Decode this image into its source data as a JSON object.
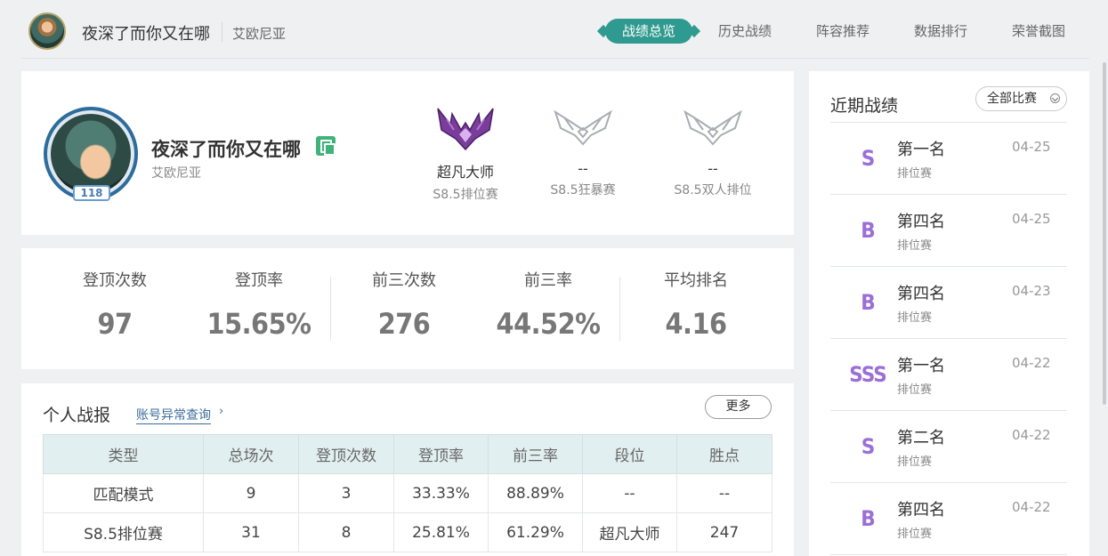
{
  "header": {
    "player_name": "夜深了而你又在哪",
    "server": "艾欧尼亚",
    "nav": [
      "战绩总览",
      "历史战绩",
      "阵容推荐",
      "数据排行",
      "荣誉截图"
    ],
    "active_nav": "战绩总览"
  },
  "profile": {
    "name": "夜深了而你又在哪",
    "server": "艾欧尼亚",
    "level": "118",
    "ranks": [
      {
        "tier": "超凡大师",
        "mode": "S8.5排位赛"
      },
      {
        "tier": "--",
        "mode": "S8.5狂暴赛"
      },
      {
        "tier": "--",
        "mode": "S8.5双人排位"
      }
    ]
  },
  "stats": [
    {
      "label": "登顶次数",
      "value": "97"
    },
    {
      "label": "登顶率",
      "value": "15.65%"
    },
    {
      "label": "前三次数",
      "value": "276"
    },
    {
      "label": "前三率",
      "value": "44.52%"
    },
    {
      "label": "平均排名",
      "value": "4.16"
    }
  ],
  "report": {
    "title": "个人战报",
    "link": "账号异常查询",
    "more": "更多",
    "columns": [
      "类型",
      "总场次",
      "登顶次数",
      "登顶率",
      "前三率",
      "段位",
      "胜点"
    ],
    "rows": [
      [
        "匹配模式",
        "9",
        "3",
        "33.33%",
        "88.89%",
        "--",
        "--"
      ],
      [
        "S8.5排位赛",
        "31",
        "8",
        "25.81%",
        "61.29%",
        "超凡大师",
        "247"
      ]
    ]
  },
  "recent": {
    "title": "近期战绩",
    "filter": "全部比赛",
    "matches": [
      {
        "grade": "S",
        "place": "第一名",
        "mode": "排位赛",
        "date": "04-25"
      },
      {
        "grade": "B",
        "place": "第四名",
        "mode": "排位赛",
        "date": "04-25"
      },
      {
        "grade": "B",
        "place": "第四名",
        "mode": "排位赛",
        "date": "04-23"
      },
      {
        "grade": "SSS",
        "place": "第一名",
        "mode": "排位赛",
        "date": "04-22"
      },
      {
        "grade": "S",
        "place": "第二名",
        "mode": "排位赛",
        "date": "04-22"
      },
      {
        "grade": "B",
        "place": "第四名",
        "mode": "排位赛",
        "date": "04-22"
      }
    ]
  },
  "colors": {
    "accent": "#2f9a8f",
    "grade": "#9b6fd6",
    "link": "#3b6d9b",
    "copy": "#3fb37a"
  }
}
